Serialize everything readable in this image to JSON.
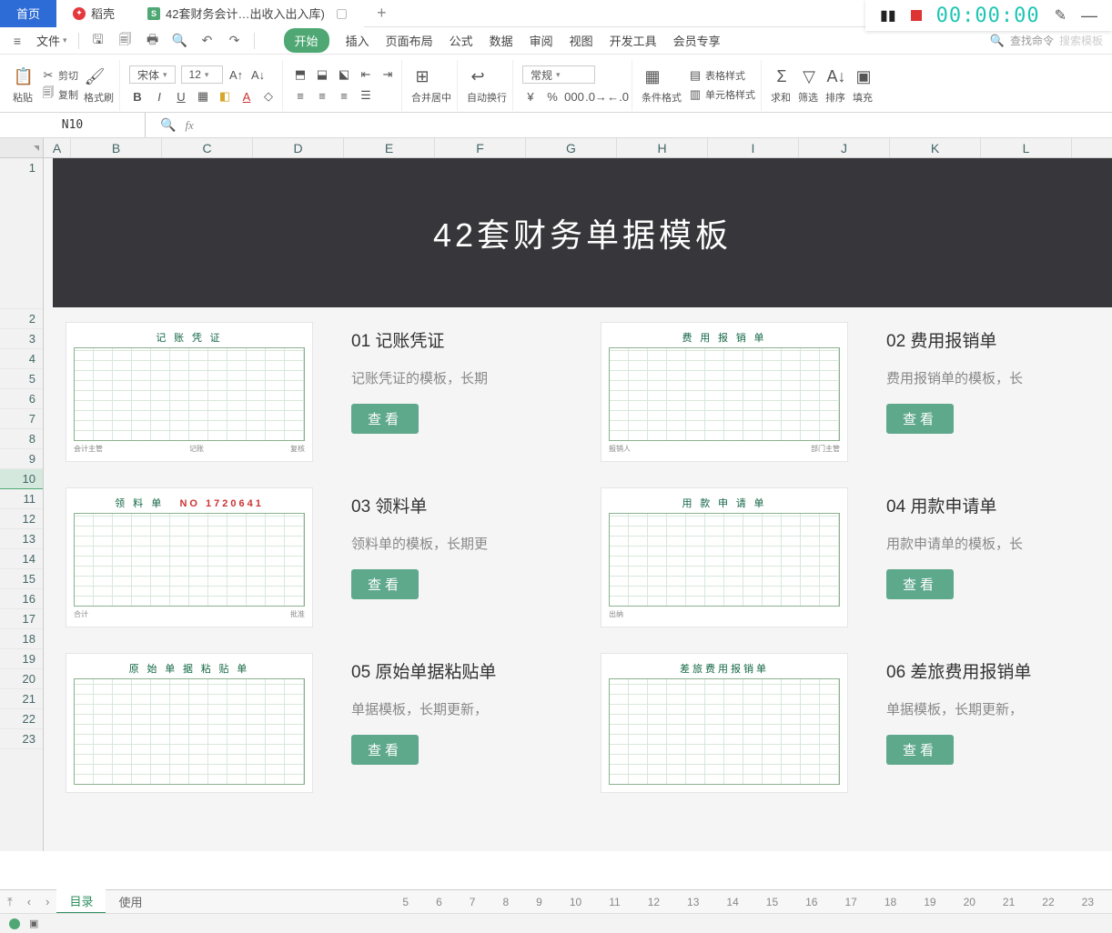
{
  "titlebar": {
    "home": "首页",
    "docer": "稻壳",
    "file": "42套财务会计…出收入出入库)",
    "add": "+"
  },
  "recorder": {
    "time": "00:00:00"
  },
  "quickbar": {
    "file_label": "文件"
  },
  "ribbon_tabs": [
    "开始",
    "插入",
    "页面布局",
    "公式",
    "数据",
    "审阅",
    "视图",
    "开发工具",
    "会员专享"
  ],
  "ribbon_search": {
    "placeholder": "查找命令",
    "template": "搜索模板"
  },
  "ribbon": {
    "paste": "粘贴",
    "cut": "剪切",
    "copy": "复制",
    "format_painter": "格式刷",
    "font_name": "宋体",
    "font_size": "12",
    "merge": "合并居中",
    "wrap": "自动换行",
    "number_format": "常规",
    "cond_fmt": "条件格式",
    "table_style": "表格样式",
    "cell_style": "单元格样式",
    "sum": "求和",
    "filter": "筛选",
    "sort": "排序",
    "fill": "填充"
  },
  "namebox": "N10",
  "columns": [
    "A",
    "B",
    "C",
    "D",
    "E",
    "F",
    "G",
    "H",
    "I",
    "J",
    "K",
    "L"
  ],
  "rows": [
    "1",
    "2",
    "3",
    "4",
    "5",
    "6",
    "7",
    "8",
    "9",
    "10",
    "11",
    "12",
    "13",
    "14",
    "15",
    "16",
    "17",
    "18",
    "19",
    "20",
    "21",
    "22",
    "23"
  ],
  "banner": "42套财务单据模板",
  "cards": [
    {
      "num": "01",
      "title": "记账凭证",
      "desc": "记账凭证的模板，长期",
      "thumb_title": "记 账 凭 证",
      "btn": "查看"
    },
    {
      "num": "02",
      "title": "费用报销单",
      "desc": "费用报销单的模板，长",
      "thumb_title": "费 用 报 销 单",
      "btn": "查看"
    },
    {
      "num": "03",
      "title": "领料单",
      "desc": "领料单的模板，长期更",
      "thumb_title": "领 料 单",
      "thumb_no": "NO   1720641",
      "btn": "查看"
    },
    {
      "num": "04",
      "title": "用款申请单",
      "desc": "用款申请单的模板，长",
      "thumb_title": "用 款 申 请 单",
      "btn": "查看"
    },
    {
      "num": "05",
      "title": "原始单据粘贴单",
      "desc": "单据模板，长期更新，",
      "thumb_title": "原 始 单 据 粘 贴 单",
      "btn": "查看"
    },
    {
      "num": "06",
      "title": "差旅费用报销单",
      "desc": "单据模板，长期更新，",
      "thumb_title": "差旅费用报销单",
      "btn": "查看"
    }
  ],
  "sheet_tabs": {
    "active": "目录",
    "tab2": "使用"
  },
  "sheet_nums": [
    "5",
    "6",
    "7",
    "8",
    "9",
    "10",
    "11",
    "12",
    "13",
    "14",
    "15",
    "16",
    "17",
    "18",
    "19",
    "20",
    "21",
    "22",
    "23"
  ]
}
